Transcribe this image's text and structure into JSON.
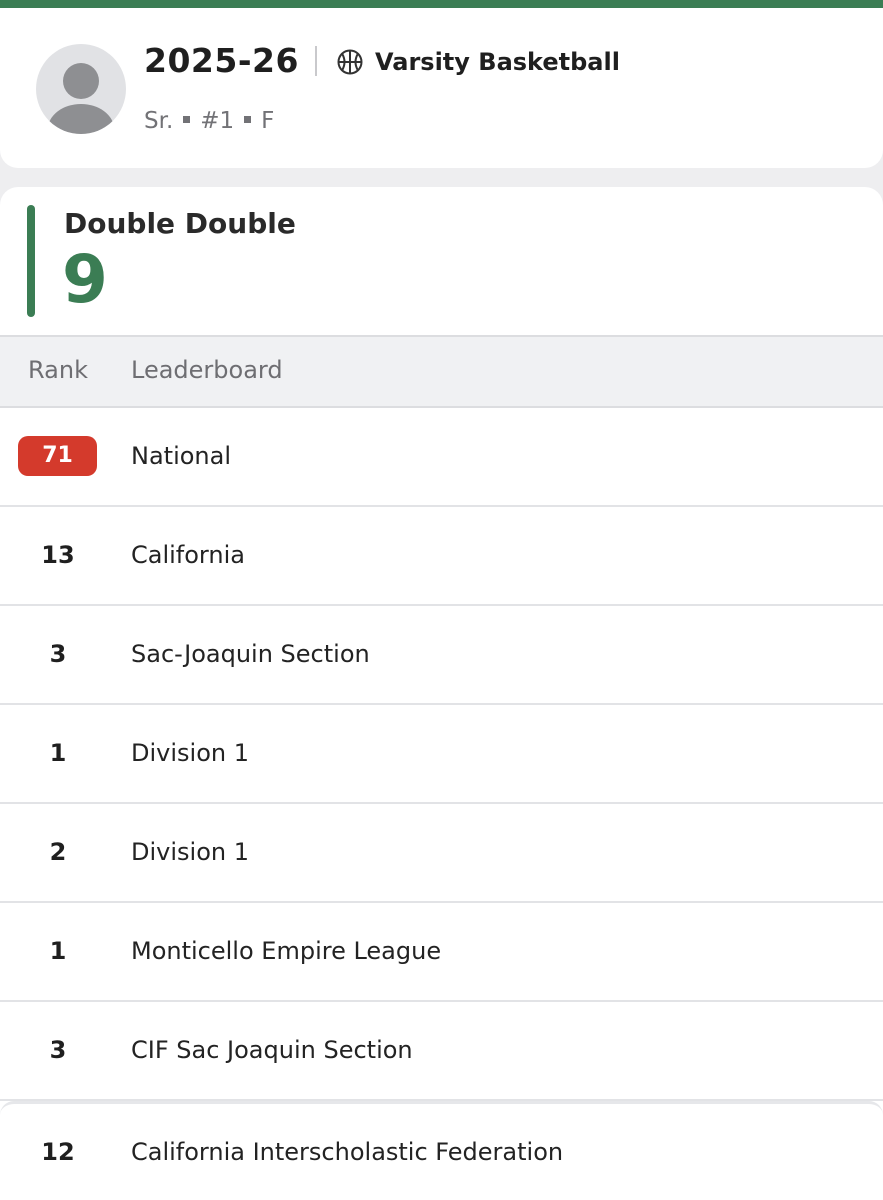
{
  "profile": {
    "season": "2025-26",
    "sport": "Varsity Basketball",
    "class_year": "Sr.",
    "jersey": "#1",
    "position": "F"
  },
  "stat": {
    "name": "Double Double",
    "value": "9",
    "accent_color": "#3b7d54"
  },
  "table": {
    "headers": {
      "rank": "Rank",
      "leaderboard": "Leaderboard"
    },
    "rows": [
      {
        "rank": "71",
        "leaderboard": "National",
        "highlight_color": "#d43a2c"
      },
      {
        "rank": "13",
        "leaderboard": "California"
      },
      {
        "rank": "3",
        "leaderboard": "Sac-Joaquin Section"
      },
      {
        "rank": "1",
        "leaderboard": "Division 1"
      },
      {
        "rank": "2",
        "leaderboard": "Division 1"
      },
      {
        "rank": "1",
        "leaderboard": "Monticello Empire League"
      },
      {
        "rank": "3",
        "leaderboard": "CIF Sac Joaquin Section"
      },
      {
        "rank": "12",
        "leaderboard": "California Interscholastic Federation"
      }
    ]
  },
  "icons": {
    "avatar": "person-placeholder-icon",
    "sport": "basketball-icon"
  }
}
